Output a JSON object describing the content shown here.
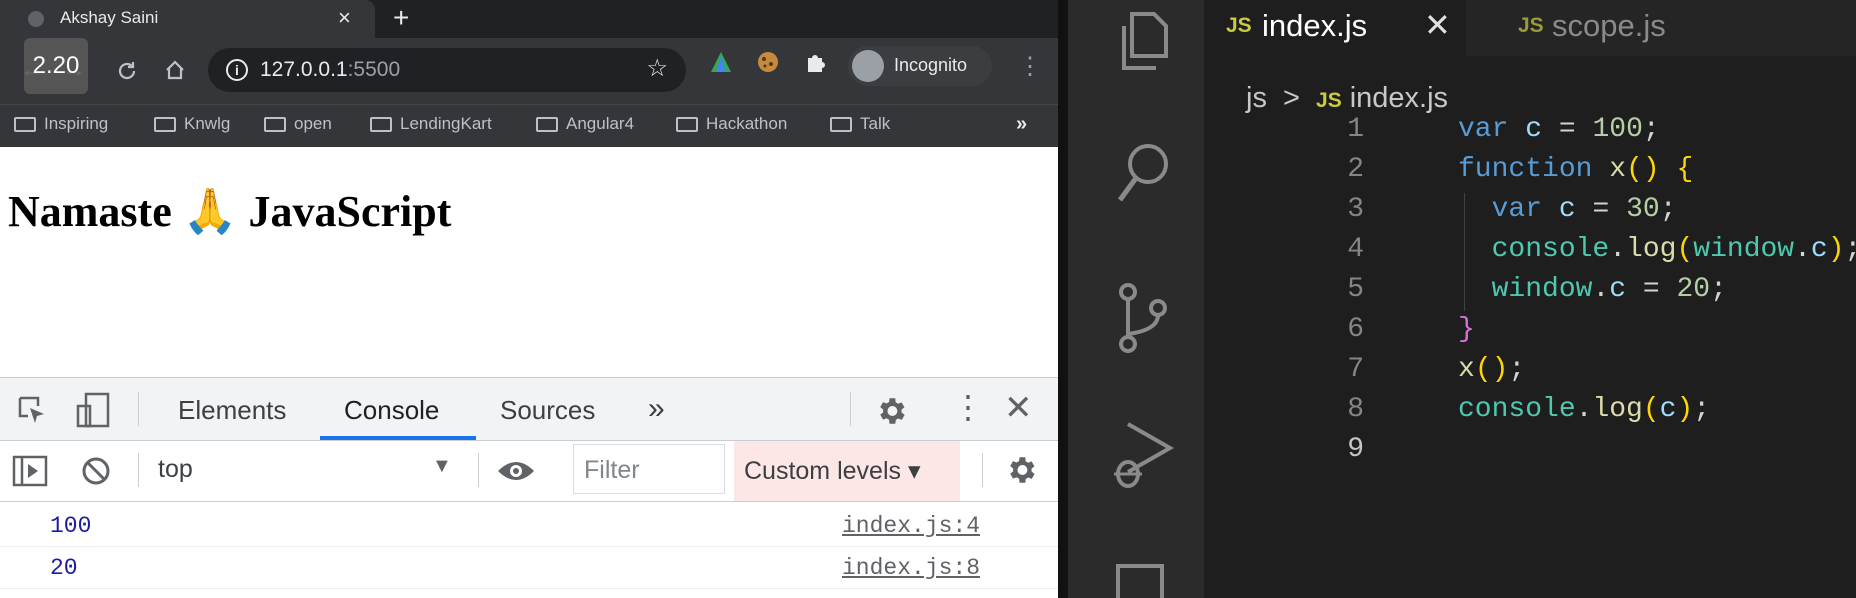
{
  "browser": {
    "tab_title": "Akshay Saini",
    "tab_close": "×",
    "new_tab": "+",
    "playback_speed": "2.20",
    "url_host": "127.0.0.1",
    "url_port": ":5500",
    "profile_label": "Incognito",
    "bookmarks": [
      "Inspiring",
      "Knwlg",
      "open",
      "LendingKart",
      "Angular4",
      "Hackathon",
      "Talk"
    ],
    "bookmarks_more": "»",
    "page_heading": "Namaste 🙏 JavaScript"
  },
  "devtools": {
    "tabs": [
      "Elements",
      "Console",
      "Sources"
    ],
    "more_tabs": "»",
    "active_tab": "Console",
    "context": "top",
    "filter_placeholder": "Filter",
    "levels": "Custom levels ▾",
    "logs": [
      {
        "value": "100",
        "source": "index.js:4"
      },
      {
        "value": "20",
        "source": "index.js:8"
      }
    ]
  },
  "editor": {
    "tabs": [
      {
        "icon": "JS",
        "name": "index.js",
        "close": "✕"
      },
      {
        "icon": "JS",
        "name": "scope.js"
      }
    ],
    "breadcrumb": {
      "folder": "js",
      "separator": ">",
      "icon": "JS",
      "file": "index.js"
    },
    "line_numbers": [
      "1",
      "2",
      "3",
      "4",
      "5",
      "6",
      "7",
      "8",
      "9"
    ],
    "code_lines": [
      "var c = 100;",
      "function x() {",
      "  var c = 30;",
      "  console.log(window.c);",
      "  window.c = 20;",
      "}",
      "x();",
      "console.log(c);",
      ""
    ]
  },
  "colors": {
    "keyword": "#569cd6",
    "variable": "#9cdcfe",
    "number": "#b5cea8",
    "function": "#dcdcaa",
    "object": "#4ec9b0",
    "console_value": "#1a1aa6",
    "devtools_accent": "#1a73e8",
    "levels_highlight": "#fde6e6"
  }
}
